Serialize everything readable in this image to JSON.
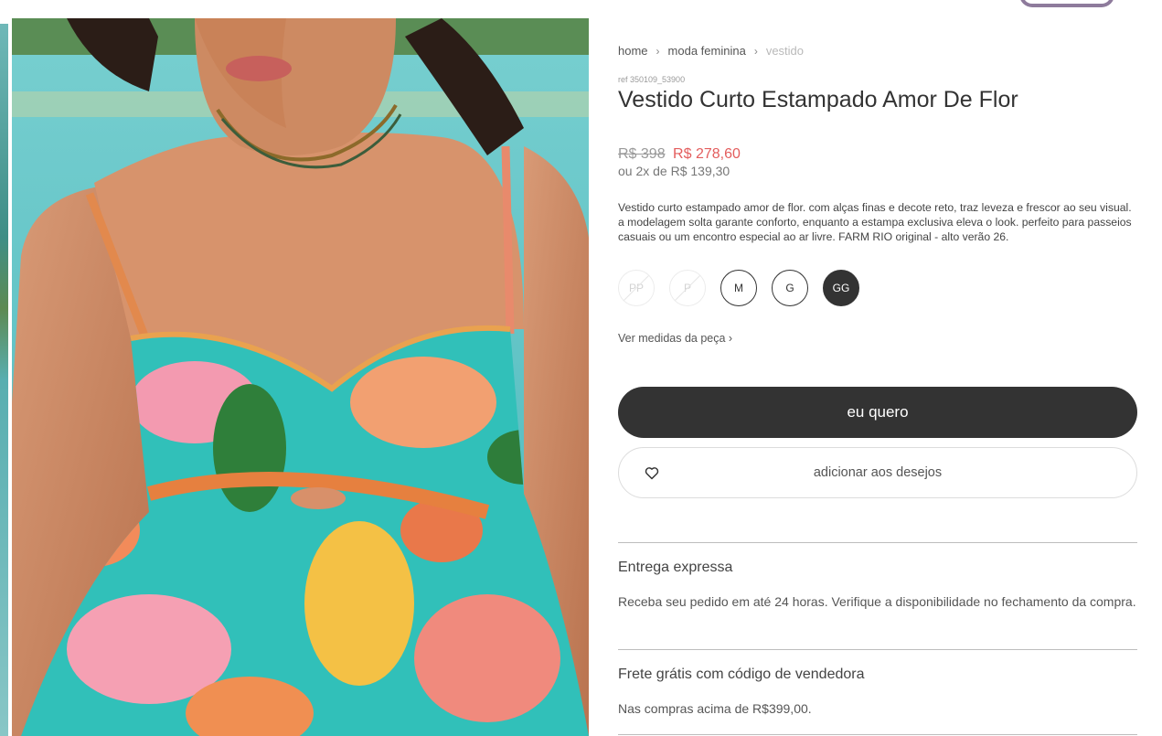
{
  "breadcrumb": {
    "home": "home",
    "category": "moda feminina",
    "current": "vestido"
  },
  "product": {
    "ref": "ref 350109_53900",
    "title": "Vestido Curto Estampado Amor De Flor",
    "old_price": "R$ 398",
    "new_price": "R$ 278,60",
    "installments": "ou 2x de R$ 139,30",
    "description": "Vestido curto estampado amor de flor. com alças finas e decote reto, traz leveza e frescor ao seu visual. a modelagem solta garante conforto, enquanto a estampa exclusiva eleva o look. perfeito para passeios casuais ou um encontro especial ao ar livre. FARM RIO original - alto verão 26."
  },
  "sizes": [
    {
      "label": "PP",
      "state": "unavailable"
    },
    {
      "label": "P",
      "state": "unavailable"
    },
    {
      "label": "M",
      "state": "available"
    },
    {
      "label": "G",
      "state": "available"
    },
    {
      "label": "GG",
      "state": "selected"
    }
  ],
  "measures_link": "Ver medidas da peça ›",
  "buy_button": "eu quero",
  "wishlist_button": {
    "label": "adicionar aos desejos",
    "icon": "heart-icon"
  },
  "shipping": [
    {
      "title": "Entrega expressa",
      "text": "Receba seu pedido em até 24 horas. Verifique a disponibilidade no fechamento da compra."
    },
    {
      "title": "Frete grátis com código de vendedora",
      "text": "Nas compras acima de R$399,00."
    }
  ],
  "colors": {
    "accent_dark": "#333333",
    "sale_red": "#e35d5d",
    "pill_purple": "#8e7b9c"
  }
}
